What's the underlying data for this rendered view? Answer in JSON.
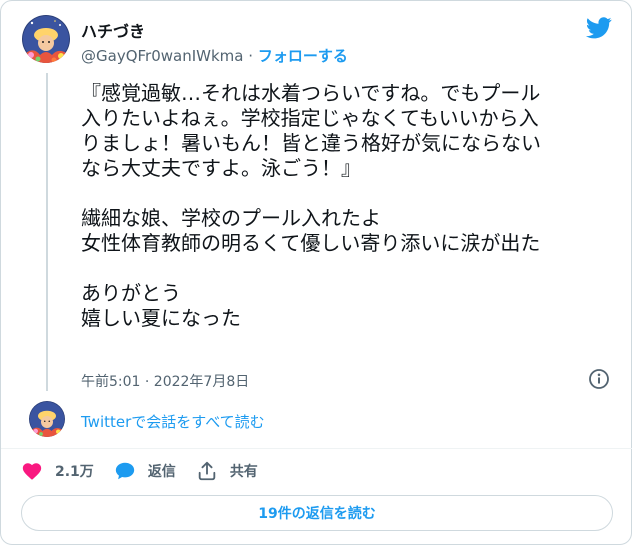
{
  "author": {
    "name": "ハチづき",
    "handle": "@GayQFr0wanIWkma",
    "separator": "·",
    "follow_label": "フォローする"
  },
  "tweet": {
    "lines": [
      "『感覚過敏…それは水着つらいですね。でもプール",
      "入りたいよねぇ。学校指定じゃなくてもいいから入",
      "りましょ！暑いもん！皆と違う格好が気にならない",
      "なら大丈夫ですよ。泳ごう！』",
      "",
      "繊細な娘、学校のプール入れたよ",
      "女性体育教師の明るくて優しい寄り添いに涙が出た",
      "",
      "ありがとう",
      "嬉しい夏になった"
    ],
    "timestamp": "午前5:01 · 2022年7月8日"
  },
  "conversation_link": "Twitterで会話をすべて読む",
  "actions": {
    "like_count": "2.1万",
    "reply_label": "返信",
    "share_label": "共有"
  },
  "replies_button": "19件の返信を読む",
  "icons": {
    "brand": "twitter-bird-icon",
    "info": "info-icon",
    "like": "heart-icon",
    "reply": "speech-bubble-icon",
    "share": "share-icon"
  },
  "colors": {
    "accent": "#1d9bf0",
    "text": "#0f1419",
    "secondary": "#536471",
    "like": "#f91880",
    "border": "#cfd9de"
  }
}
